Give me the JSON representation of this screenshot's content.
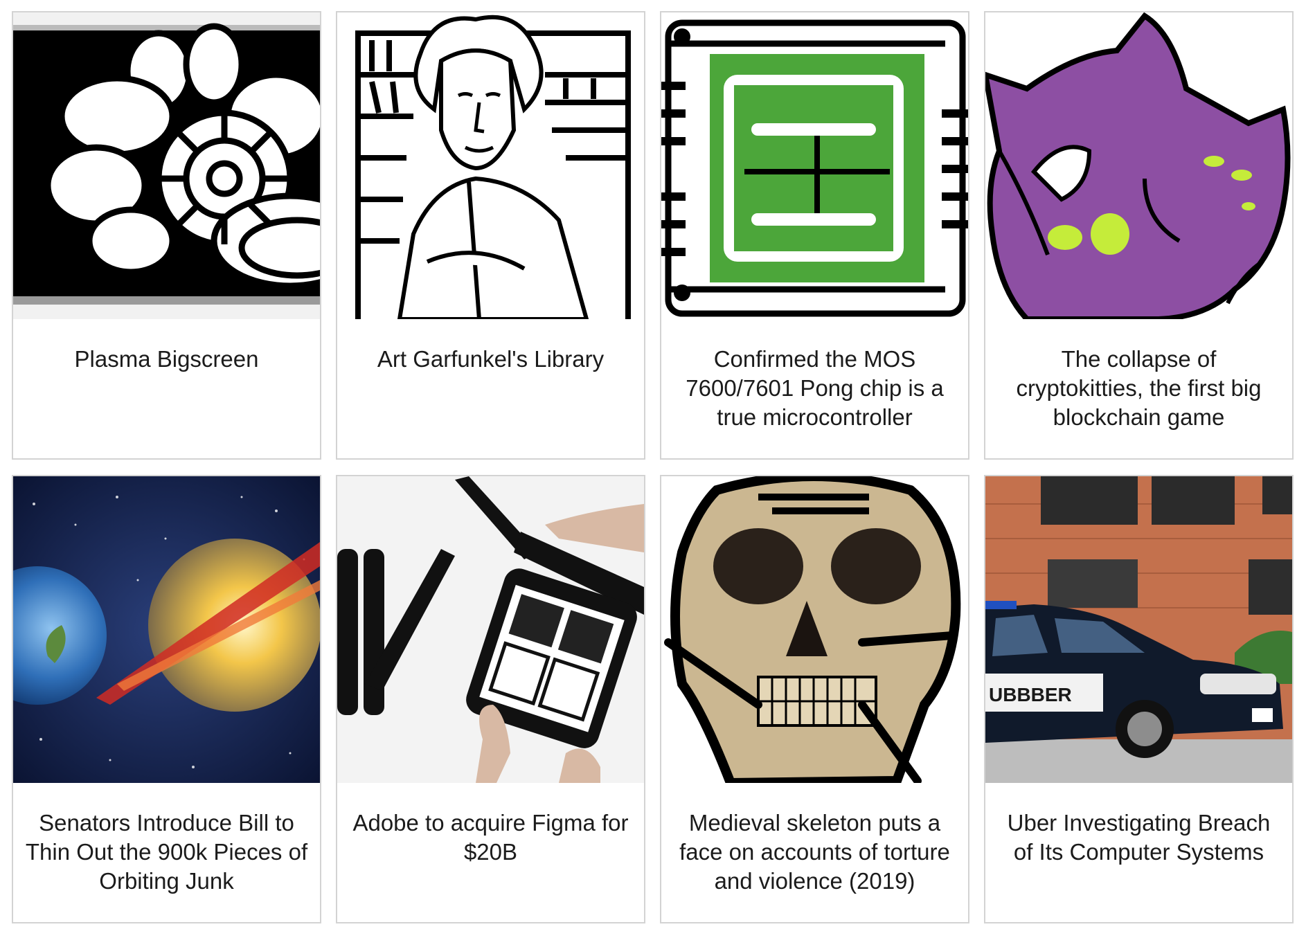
{
  "cards": [
    {
      "title": "Plasma Bigscreen"
    },
    {
      "title": "Art Garfunkel's Library"
    },
    {
      "title": "Confirmed the MOS 7600/7601 Pong chip is a true microcontroller"
    },
    {
      "title": "The collapse of cryptokitties, the first big blockchain game"
    },
    {
      "title": "Senators Introduce Bill to Thin Out the 900k Pieces of Orbiting Junk"
    },
    {
      "title": "Adobe to acquire Figma for $20B"
    },
    {
      "title": "Medieval skeleton puts a face on accounts of torture and violence (2019)"
    },
    {
      "title": "Uber Investigating Breach of Its Computer Systems",
      "sign_text": "UBBBER"
    }
  ],
  "colors": {
    "card_border": "#d3d3d3",
    "caption_text": "#1b1b1b",
    "chip_green": "#4ca63a",
    "kitty_purple": "#8d4fa3",
    "kitty_spots": "#c5ec3a"
  }
}
